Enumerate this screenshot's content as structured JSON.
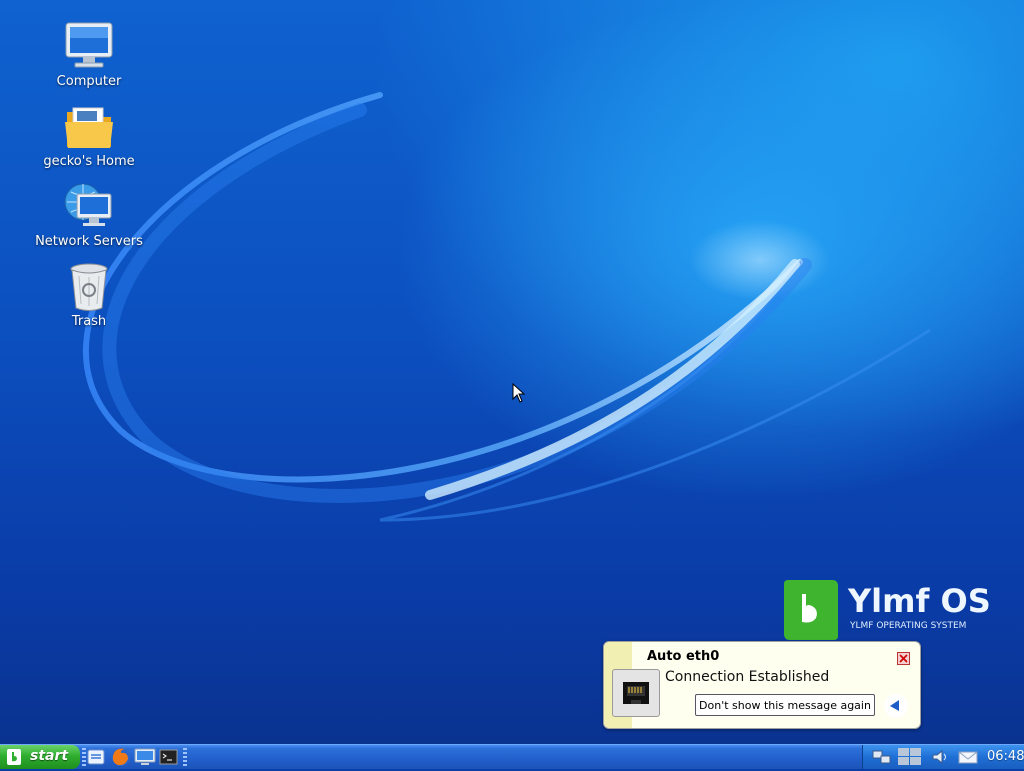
{
  "desktop": {
    "icons": [
      {
        "label": "Computer",
        "icon": "computer-icon"
      },
      {
        "label": "gecko's Home",
        "icon": "home-folder-icon"
      },
      {
        "label": "Network Servers",
        "icon": "network-servers-icon"
      },
      {
        "label": "Trash",
        "icon": "trash-icon"
      }
    ],
    "brand": {
      "name": "Ylmf OS",
      "subtitle": "YLMF OPERATING SYSTEM"
    }
  },
  "notification": {
    "title": "Auto eth0",
    "message": "Connection Established",
    "action_label": "Don't show this message again",
    "icon": "ethernet-icon"
  },
  "taskbar": {
    "start_label": "start",
    "quick_launch": [
      "file-manager-icon",
      "firefox-icon",
      "show-desktop-icon",
      "terminal-icon"
    ],
    "tray": [
      "network-icon",
      "workspace-switcher-icon",
      "volume-icon",
      "mail-icon"
    ],
    "clock": "06:48"
  },
  "colors": {
    "taskbar": "#225fcb",
    "start": "#2fae2f",
    "desktop": "#0c4fbf"
  }
}
